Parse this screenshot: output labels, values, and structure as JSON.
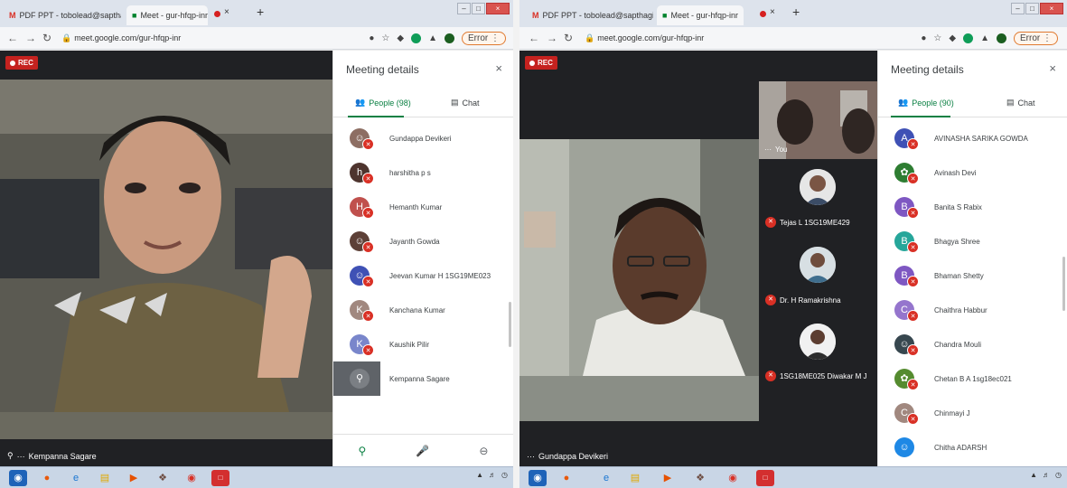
{
  "left": {
    "tabs": [
      {
        "label": "PDF PPT - tobolead@sapthagir..",
        "close": "x"
      },
      {
        "label": "Meet - gur-hfqp-inr"
      }
    ],
    "url": "meet.google.com/gur-hfqp-inr",
    "error_label": "Error",
    "rec_label": "REC",
    "presenter_name": "Kempanna Sagare",
    "panel": {
      "title": "Meeting details",
      "close": "×",
      "people_tab": "People (98)",
      "chat_tab": "Chat",
      "people": [
        {
          "name": "Gundappa Devikeri",
          "initial": "",
          "color": "#8d6e63"
        },
        {
          "name": "harshitha p s",
          "initial": "h",
          "color": "#4e342e"
        },
        {
          "name": "Hemanth Kumar",
          "initial": "H",
          "color": "#c0504d"
        },
        {
          "name": "Jayanth Gowda",
          "initial": "",
          "color": "#5d4037"
        },
        {
          "name": "Jeevan Kumar H 1SG19ME023",
          "initial": "",
          "color": "#3f51b5"
        },
        {
          "name": "Kanchana Kumar",
          "initial": "K",
          "color": "#a1887f"
        },
        {
          "name": "Kaushik Pilir",
          "initial": "K",
          "color": "#7986cb"
        },
        {
          "name": "Kempanna Sagare",
          "initial": "",
          "color": "#5f6368"
        }
      ]
    }
  },
  "right": {
    "tabs": [
      {
        "label": "PDF PPT - tobolead@sapthagir..",
        "close": "x"
      },
      {
        "label": "Meet - gur-hfqp-inr"
      }
    ],
    "url": "meet.google.com/gur-hfqp-inr",
    "error_label": "Error",
    "rec_label": "REC",
    "presenter_name": "Gundappa Devikeri",
    "self_label": "You",
    "tiles": [
      {
        "name": "Tejas L 1SG19ME429"
      },
      {
        "name": "Dr. H Ramakrishna"
      },
      {
        "name": "1SG18ME025 Diwakar M J"
      }
    ],
    "panel": {
      "title": "Meeting details",
      "close": "×",
      "people_tab": "People (90)",
      "chat_tab": "Chat",
      "people": [
        {
          "name": "AVINASHA SARIKA GOWDA",
          "initial": "A",
          "color": "#3f51b5"
        },
        {
          "name": "Avinash Devi",
          "initial": "",
          "color": "#2e7d32"
        },
        {
          "name": "Banita S Rabix",
          "initial": "B",
          "color": "#7e57c2"
        },
        {
          "name": "Bhagya Shree",
          "initial": "B",
          "color": "#26a69a"
        },
        {
          "name": "Bhaman Shetty",
          "initial": "B",
          "color": "#7e57c2"
        },
        {
          "name": "Chaithra Habbur",
          "initial": "C",
          "color": "#9575cd"
        },
        {
          "name": "Chandra Mouli",
          "initial": "",
          "color": "#37474f"
        },
        {
          "name": "Chetan B A 1sg18ec021",
          "initial": "",
          "color": "#558b2f"
        },
        {
          "name": "Chinmayi J",
          "initial": "C",
          "color": "#a1887f"
        },
        {
          "name": "Chitha ADARSH",
          "initial": "",
          "color": "#1e88e5"
        }
      ]
    }
  }
}
